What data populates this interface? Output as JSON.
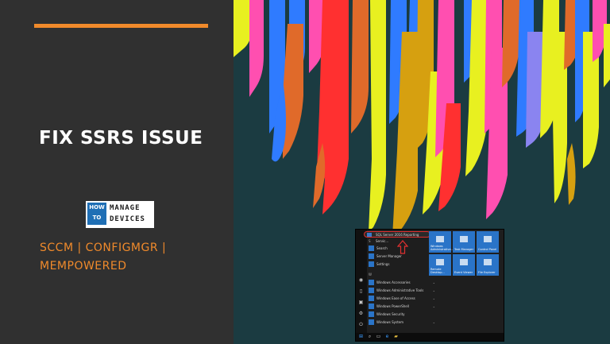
{
  "slide": {
    "title": "FIX SSRS ISSUE",
    "tagline_line1": "SCCM | CONFIGMGR |",
    "tagline_line2": "MEMPOWERED",
    "accent_color": "#f08a2b"
  },
  "logo": {
    "how": "HOW",
    "to": "TO",
    "line1": "MANAGE",
    "line2": "DEVICES"
  },
  "start_menu": {
    "search_result": "SQL Server 2016 Reporting Servic...",
    "section_s": "S",
    "section_w": "W",
    "s_items": [
      "Search",
      "Server Manager",
      "Settings"
    ],
    "w_items": [
      "Windows Accessories",
      "Windows Administrative Tools",
      "Windows Ease of Access",
      "Windows PowerShell",
      "Windows Security",
      "Windows System"
    ],
    "tiles": [
      "Windows Administrative...",
      "Task Manager",
      "Control Panel",
      "Remote Desktop...",
      "Event Viewer",
      "File Explorer"
    ]
  },
  "icons": [
    "gear-icon",
    "power-icon",
    "search-icon",
    "task-view-icon",
    "edge-icon",
    "folder-icon",
    "windows-logo-icon"
  ]
}
